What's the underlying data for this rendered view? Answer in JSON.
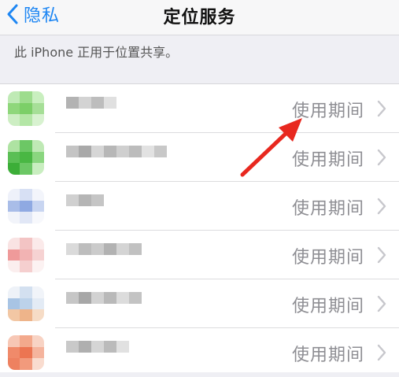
{
  "navbar": {
    "back_label": "隐私",
    "title": "定位服务"
  },
  "caption": "此 iPhone 正用于位置共享。",
  "rows": [
    {
      "status": "使用期间",
      "icon_color": "#8fd77b"
    },
    {
      "status": "使用期间",
      "icon_color": "#6cc765"
    },
    {
      "status": "使用期间",
      "icon_color": "#a9bde8"
    },
    {
      "status": "使用期间",
      "icon_color": "#ef9a9a"
    },
    {
      "status": "使用期间",
      "icon_color": "#a8c4e4"
    },
    {
      "status": "使用期间",
      "icon_color": "#f08a6a"
    }
  ],
  "colors": {
    "accent": "#1d86f3",
    "annotation_arrow": "#e8281f"
  }
}
